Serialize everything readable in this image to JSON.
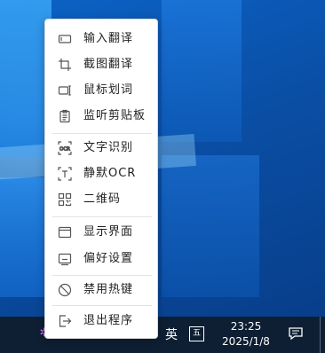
{
  "menu": {
    "items": [
      {
        "label": "输入翻译",
        "icon": "input-translate-icon"
      },
      {
        "label": "截图翻译",
        "icon": "crop-icon"
      },
      {
        "label": "鼠标划词",
        "icon": "text-select-icon"
      },
      {
        "label": "监听剪贴板",
        "icon": "clipboard-icon"
      },
      {
        "label": "文字识别",
        "icon": "ocr-icon"
      },
      {
        "label": "静默OCR",
        "icon": "silent-ocr-icon"
      },
      {
        "label": "二维码",
        "icon": "qr-code-icon"
      },
      {
        "label": "显示界面",
        "icon": "window-icon"
      },
      {
        "label": "偏好设置",
        "icon": "settings-icon"
      },
      {
        "label": "禁用热键",
        "icon": "disable-icon"
      },
      {
        "label": "退出程序",
        "icon": "exit-icon"
      }
    ]
  },
  "taskbar": {
    "ime_label": "英",
    "ime_mode": "五",
    "time": "23:25",
    "date": "2025/1/8"
  }
}
